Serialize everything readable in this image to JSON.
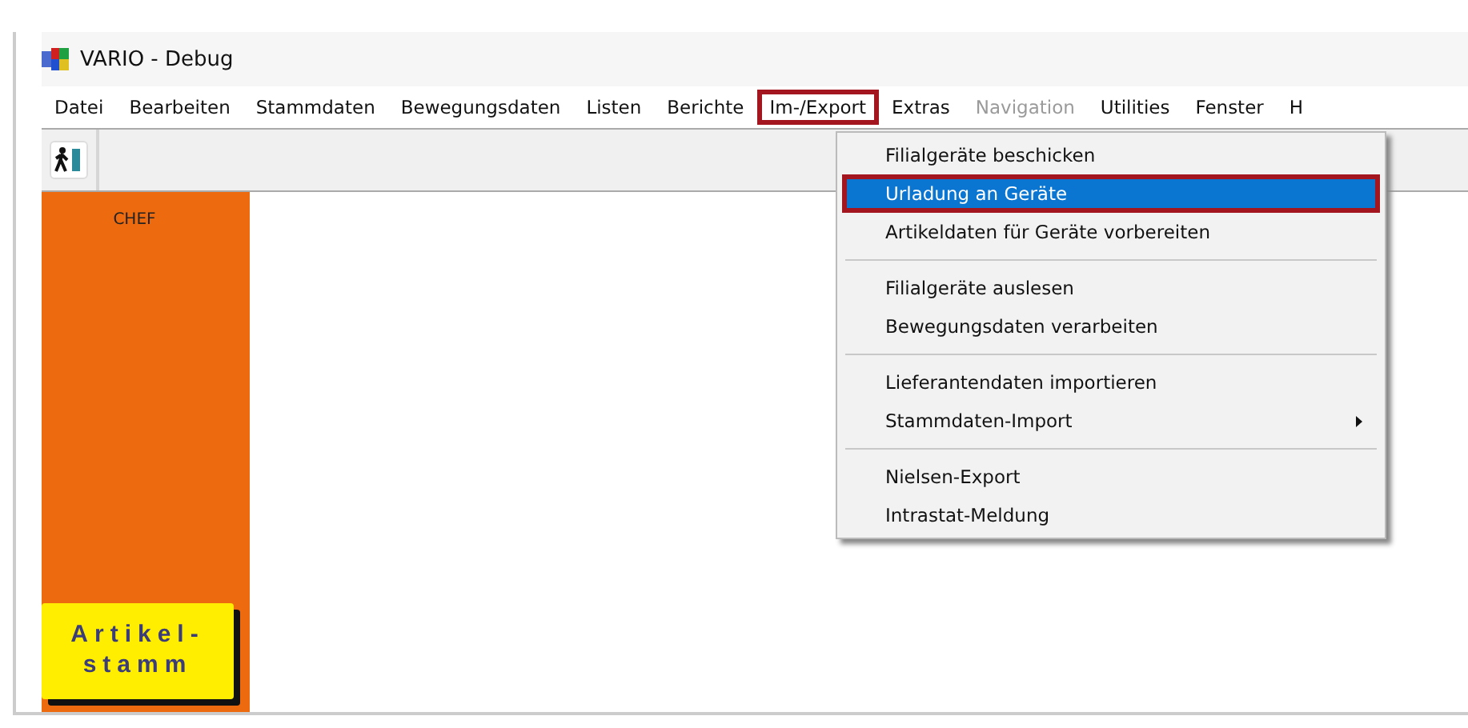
{
  "window": {
    "title": "VARIO - Debug"
  },
  "menu_bar": [
    {
      "label": "Datei",
      "disabled": false,
      "highlighted": false
    },
    {
      "label": "Bearbeiten",
      "disabled": false,
      "highlighted": false
    },
    {
      "label": "Stammdaten",
      "disabled": false,
      "highlighted": false
    },
    {
      "label": "Bewegungsdaten",
      "disabled": false,
      "highlighted": false
    },
    {
      "label": "Listen",
      "disabled": false,
      "highlighted": false
    },
    {
      "label": "Berichte",
      "disabled": false,
      "highlighted": false
    },
    {
      "label": "Im-/Export",
      "disabled": false,
      "highlighted": true
    },
    {
      "label": "Extras",
      "disabled": false,
      "highlighted": false
    },
    {
      "label": "Navigation",
      "disabled": true,
      "highlighted": false
    },
    {
      "label": "Utilities",
      "disabled": false,
      "highlighted": false
    },
    {
      "label": "Fenster",
      "disabled": false,
      "highlighted": false
    },
    {
      "label": "H",
      "disabled": false,
      "highlighted": false
    }
  ],
  "dropdown": {
    "groups": [
      [
        {
          "label": "Filialgeräte beschicken",
          "selected": false,
          "highlighted": false,
          "submenu": false
        },
        {
          "label": "Urladung an Geräte",
          "selected": true,
          "highlighted": true,
          "submenu": false
        },
        {
          "label": "Artikeldaten für Geräte vorbereiten",
          "selected": false,
          "highlighted": false,
          "submenu": false
        }
      ],
      [
        {
          "label": "Filialgeräte auslesen",
          "selected": false,
          "highlighted": false,
          "submenu": false
        },
        {
          "label": "Bewegungsdaten verarbeiten",
          "selected": false,
          "highlighted": false,
          "submenu": false
        }
      ],
      [
        {
          "label": "Lieferantendaten importieren",
          "selected": false,
          "highlighted": false,
          "submenu": false
        },
        {
          "label": "Stammdaten-Import",
          "selected": false,
          "highlighted": false,
          "submenu": true
        }
      ],
      [
        {
          "label": "Nielsen-Export",
          "selected": false,
          "highlighted": false,
          "submenu": false
        },
        {
          "label": "Intrastat-Meldung",
          "selected": false,
          "highlighted": false,
          "submenu": false
        }
      ]
    ]
  },
  "side_panel": {
    "user": "CHEF",
    "button": {
      "line_1": "Artikel-",
      "line_2": "stamm"
    }
  }
}
